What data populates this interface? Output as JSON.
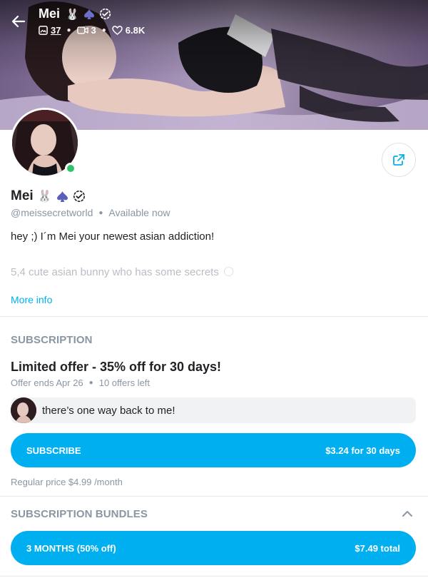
{
  "header": {
    "name": "Mei",
    "stats": {
      "photos": "37",
      "videos": "3",
      "likes": "6.8K"
    }
  },
  "profile": {
    "name": "Mei",
    "handle": "@meissecretworld",
    "status": "Available now",
    "bio_line1": "hey ;) I´m Mei your newest asian addiction!",
    "bio_line2": "5,4 cute asian bunny who has some secrets",
    "more_info": "More info"
  },
  "subscription": {
    "section_title": "SUBSCRIPTION",
    "offer_title": "Limited offer - 35% off for 30 days!",
    "offer_ends": "Offer ends Apr 26",
    "offers_left": "10 offers left",
    "message": "there’s one way back to me!",
    "button_label": "SUBSCRIBE",
    "button_price": "$3.24 for 30 days",
    "regular_price": "Regular price $4.99 /month"
  },
  "bundles": {
    "section_title": "SUBSCRIPTION BUNDLES",
    "items": [
      {
        "label": "3 MONTHS (50% off)",
        "price": "$7.49 total"
      }
    ]
  },
  "colors": {
    "accent": "#00aff0",
    "muted": "#8a96a3",
    "online": "#2fc36b"
  },
  "icons": [
    "back-arrow-icon",
    "bunny-emoji-icon",
    "spade-icon",
    "verified-icon",
    "image-icon",
    "video-icon",
    "heart-icon",
    "share-icon",
    "chevron-up-icon",
    "moon-emoji-icon"
  ]
}
